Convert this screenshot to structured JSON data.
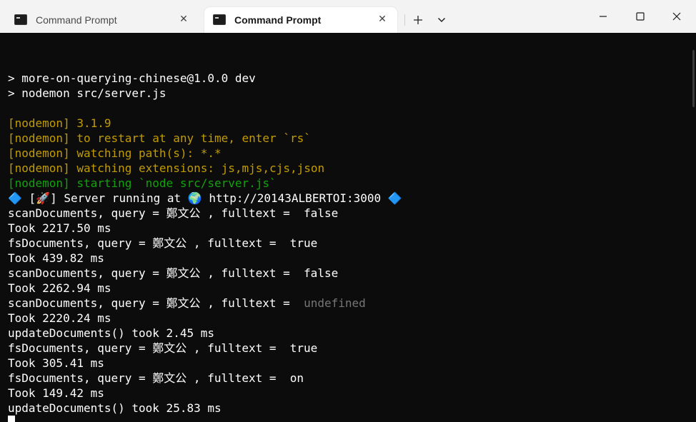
{
  "window": {
    "tabs": [
      {
        "title": "Command Prompt",
        "active": false
      },
      {
        "title": "Command Prompt",
        "active": true
      }
    ],
    "controls": {
      "new_tab": "+",
      "dropdown": "⌄",
      "close_tab": "✕"
    }
  },
  "terminal": {
    "colors": {
      "background": "#0c0c0c",
      "default": "#ffffff",
      "nodemon_yellow": "#c19c00",
      "nodemon_green": "#13a10e",
      "muted_gray": "#767676",
      "diamond_blue": "#3b78ff"
    },
    "lines": [
      {
        "text": "",
        "color": "default"
      },
      {
        "text": "> more-on-querying-chinese@1.0.0 dev",
        "color": "default"
      },
      {
        "text": "> nodemon src/server.js",
        "color": "default"
      },
      {
        "text": "",
        "color": "default"
      },
      {
        "text": "[nodemon] 3.1.9",
        "color": "yellow"
      },
      {
        "text": "[nodemon] to restart at any time, enter `rs`",
        "color": "yellow"
      },
      {
        "text": "[nodemon] watching path(s): *.*",
        "color": "yellow"
      },
      {
        "text": "[nodemon] watching extensions: js,mjs,cjs,json",
        "color": "yellow"
      },
      {
        "text": "[nodemon] starting `node src/server.js`",
        "color": "green"
      },
      {
        "segments": [
          {
            "text": "🔷",
            "color": "blue"
          },
          {
            "text": " [🚀] Server running at 🌍 http://20143ALBERTOI:3000 ",
            "color": "default"
          },
          {
            "text": "🔷",
            "color": "blue"
          }
        ]
      },
      {
        "text": "scanDocuments, query = 鄭文公 , fulltext =  false",
        "color": "default"
      },
      {
        "text": "Took 2217.50 ms",
        "color": "default"
      },
      {
        "text": "fsDocuments, query = 鄭文公 , fulltext =  true",
        "color": "default"
      },
      {
        "text": "Took 439.82 ms",
        "color": "default"
      },
      {
        "text": "scanDocuments, query = 鄭文公 , fulltext =  false",
        "color": "default"
      },
      {
        "text": "Took 2262.94 ms",
        "color": "default"
      },
      {
        "segments": [
          {
            "text": "scanDocuments, query = 鄭文公 , fulltext =  ",
            "color": "default"
          },
          {
            "text": "undefined",
            "color": "gray"
          }
        ]
      },
      {
        "text": "Took 2220.24 ms",
        "color": "default"
      },
      {
        "text": "updateDocuments() took 2.45 ms",
        "color": "default"
      },
      {
        "text": "fsDocuments, query = 鄭文公 , fulltext =  true",
        "color": "default"
      },
      {
        "text": "Took 305.41 ms",
        "color": "default"
      },
      {
        "text": "fsDocuments, query = 鄭文公 , fulltext =  on",
        "color": "default"
      },
      {
        "text": "Took 149.42 ms",
        "color": "default"
      },
      {
        "text": "updateDocuments() took 25.83 ms",
        "color": "default"
      }
    ]
  }
}
